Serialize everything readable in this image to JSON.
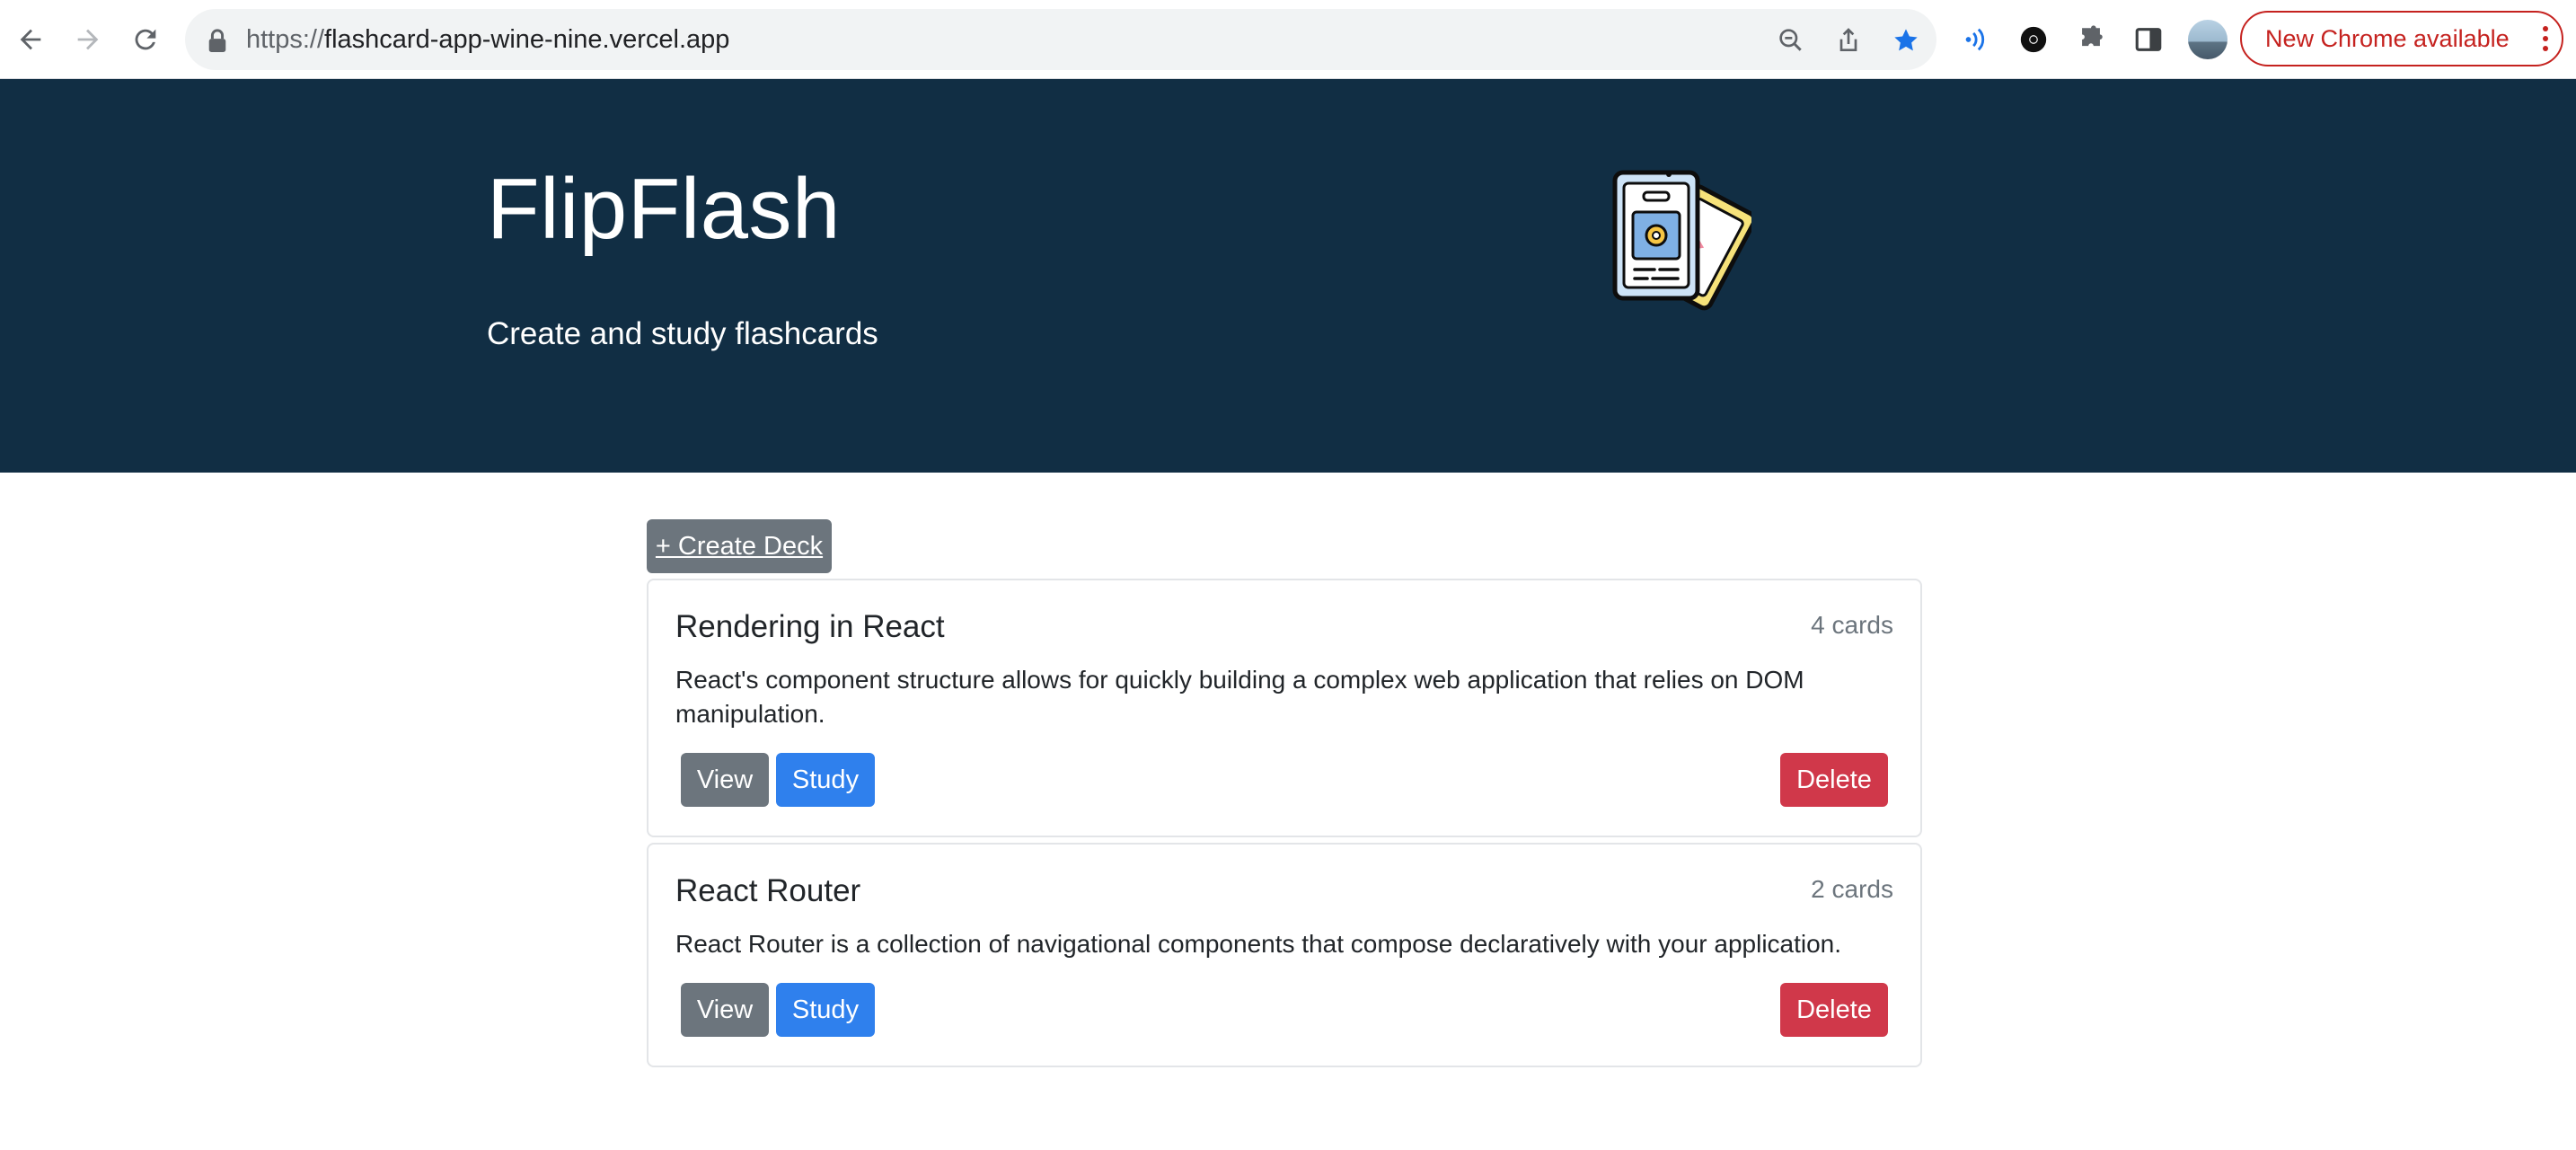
{
  "browser": {
    "url_scheme": "https://",
    "url_host": "flashcard-app-wine-nine.vercel.app",
    "update_label": "New Chrome available",
    "icons": {
      "back": "arrow-left-icon",
      "forward": "arrow-right-icon",
      "reload": "reload-icon",
      "lock": "lock-icon",
      "zoom": "zoom-out-icon",
      "share": "share-icon",
      "bookmark": "star-icon",
      "extensions": [
        "audio-extension-icon",
        "es-extension-icon",
        "puzzle-icon",
        "side-panel-icon"
      ],
      "menu": "kebab-menu-icon"
    },
    "colors": {
      "bookmark_star": "#1a73e8",
      "update_accent": "#c5221f"
    }
  },
  "hero": {
    "title": "FlipFlash",
    "subtitle": "Create and study flashcards",
    "background": "#112e44",
    "logo_icon": "flashcards-logo-icon"
  },
  "actions": {
    "create_deck_label": "+ Create Deck"
  },
  "decks": [
    {
      "name": "Rendering in React",
      "count": "4 cards",
      "description": "React's component structure allows for quickly building a complex web application that relies on DOM manipulation.",
      "view_label": "View",
      "study_label": "Study",
      "delete_label": "Delete"
    },
    {
      "name": "React Router",
      "count": "2 cards",
      "description": "React Router is a collection of navigational components that compose declaratively with your application.",
      "view_label": "View",
      "study_label": "Study",
      "delete_label": "Delete"
    }
  ],
  "colors": {
    "secondary": "#6c757d",
    "primary": "#2f80ed",
    "danger": "#d0384a"
  }
}
